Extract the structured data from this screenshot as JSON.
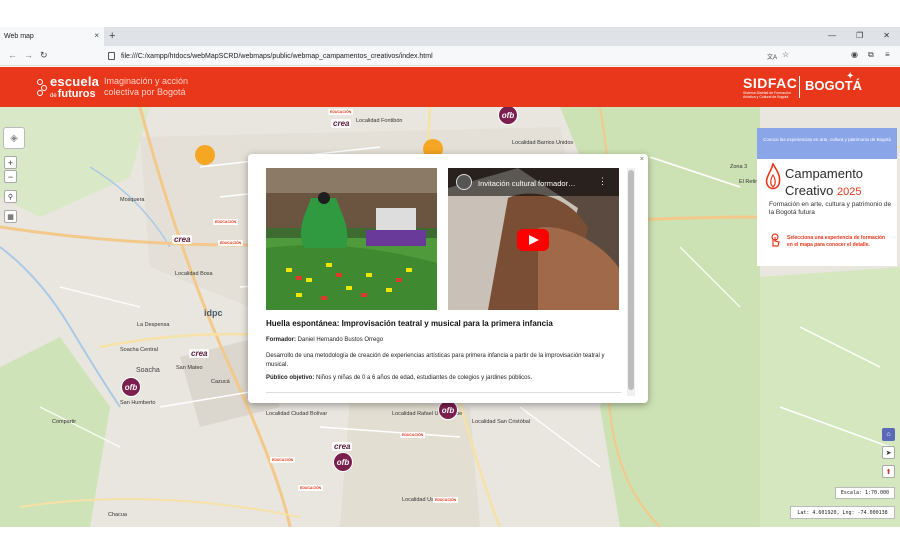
{
  "browser": {
    "tab_title": "Web map",
    "tab_close": "×",
    "new_tab": "+",
    "url": "file:///C:/xampp/htdocs/webMapSCRD/webmaps/public/webmap_campamentos_creativos/index.html",
    "win_min": "—",
    "win_max": "❐",
    "win_close": "✕",
    "back": "←",
    "forward": "→",
    "reload": "↻",
    "translate": "文A",
    "star": "☆",
    "profile": "◉",
    "extensions": "⧉",
    "menu": "≡"
  },
  "header": {
    "logo_line1": "escuela",
    "logo_line2_small": "de",
    "logo_line2": "futuros",
    "tagline_line1": "Imaginación y acción",
    "tagline_line2": "colectiva por Bogotá",
    "sidfac": "SIDFAC",
    "sidfac_sub": "Sistema Distrital de Formación Artística y Cultural de Bogotá",
    "bogota": "BOGOTÁ",
    "accent_color": "#e8371a"
  },
  "map_labels": {
    "fontibon": "Localidad Fontibón",
    "barrios_unidos": "Localidad Barrios Unidos",
    "bosa": "Localidad Bosa",
    "soacha_central": "Soacha Central",
    "la_despensa": "La Despensa",
    "san_mateo": "San Mateo",
    "soacha": "Soacha",
    "san_humberto": "San Humberto",
    "localidad_ciudad_bolivar": "Localidad Ciudad Bolívar",
    "localidad_rafael_uribe": "Localidad Rafael Uribe Uribe",
    "localidad_san_cristobal": "Localidad San Cristóbal",
    "localidad_usme": "Localidad Usme",
    "compartir": "Compartir",
    "cazuca": "Cazucá",
    "chacua": "Chacua",
    "zona3": "Zona 3",
    "el_retiro": "El Retiro",
    "mosquera": "Mosquera"
  },
  "markers": {
    "ofb": "ofb",
    "crea": "crea",
    "educacion": "EDUCACIÓN",
    "idpc": "idpc"
  },
  "controls": {
    "zoom_in": "+",
    "zoom_out": "−",
    "layers_icon": "layers-icon",
    "scale": "Escala: 1:70.000",
    "coords": "Lat: 4.601920, Lng: -74.000138"
  },
  "panel": {
    "top_text": "Conoce las experiencias en arte, cultura y patrimonio de Bogotá",
    "title_line1": "Campamento",
    "title_line2": "Creativo",
    "year": "2025",
    "subtitle": "Formación en arte, cultura y patrimonio de la Bogotá futura",
    "hint": "Selecciona una experiencia de formación en el mapa para conocer el detalle."
  },
  "popup": {
    "close": "×",
    "video_title": "Invitación cultural formador…",
    "video_menu": "⋮",
    "title": "Huella espontánea: Improvisación teatral y musical para la primera infancia",
    "formador_label": "Formador:",
    "formador": "Daniel Hernando Bustos Orrego",
    "description": "Desarrollo de una metodología de creación de experiencias artísticas para primera infancia a partir de la improvisación teatral y musical.",
    "publico_label": "Público objetivo:",
    "publico": "Niños y niñas de 0 a 6 años de edad, estudiantes de colegios y jardines públicos."
  }
}
